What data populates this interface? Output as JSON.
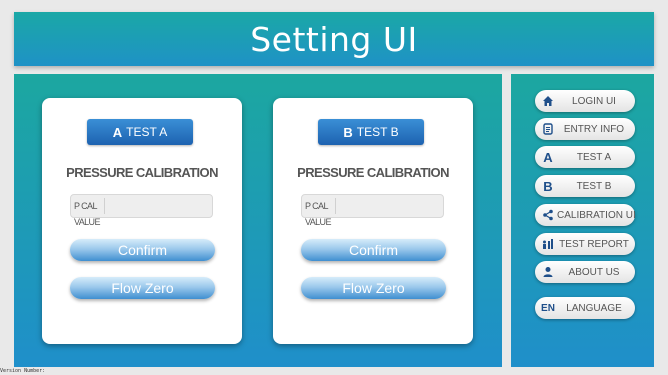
{
  "header": {
    "title": "Setting UI"
  },
  "cards": [
    {
      "test_letter": "A",
      "test_label": "TEST A",
      "section_title": "PRESSURE CALIBRATION",
      "field_label": "P CAL VALUE",
      "field_value": "",
      "confirm_label": "Confirm",
      "flow_zero_label": "Flow Zero"
    },
    {
      "test_letter": "B",
      "test_label": "TEST B",
      "section_title": "PRESSURE CALIBRATION",
      "field_label": "P CAL VALUE",
      "field_value": "",
      "confirm_label": "Confirm",
      "flow_zero_label": "Flow Zero"
    }
  ],
  "sidebar": {
    "items": [
      {
        "label": "LOGIN UI",
        "icon": "home-icon"
      },
      {
        "label": "ENTRY INFO",
        "icon": "document-icon"
      },
      {
        "label": "TEST A",
        "icon": "letter-a-icon",
        "icon_text": "A"
      },
      {
        "label": "TEST B",
        "icon": "letter-b-icon",
        "icon_text": "B"
      },
      {
        "label": "CALIBRATION UI",
        "icon": "share-icon"
      },
      {
        "label": "TEST REPORT",
        "icon": "report-icon"
      },
      {
        "label": "ABOUT US",
        "icon": "user-icon"
      },
      {
        "label": "LANGUAGE",
        "icon": "language-icon",
        "icon_text": "EN"
      }
    ]
  },
  "footer": {
    "version_text": "Version Number:"
  },
  "colors": {
    "accent_teal": "#1ca7a0",
    "accent_blue": "#1f8fca",
    "icon_blue": "#1f4f8a"
  }
}
